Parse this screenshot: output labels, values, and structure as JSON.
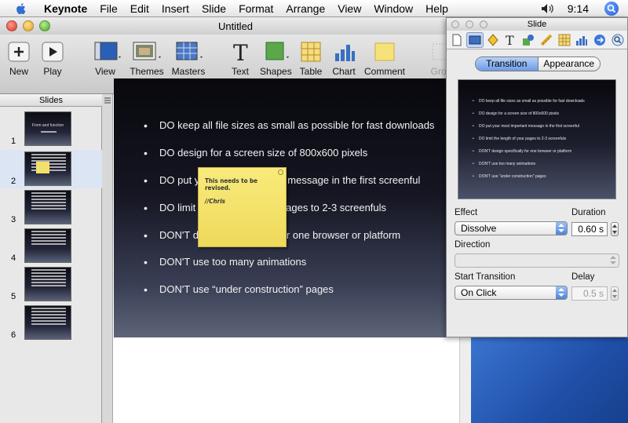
{
  "menubar": {
    "app": "Keynote",
    "items": [
      "File",
      "Edit",
      "Insert",
      "Slide",
      "Format",
      "Arrange",
      "View",
      "Window",
      "Help"
    ],
    "clock": "9:14"
  },
  "window": {
    "title": "Untitled"
  },
  "toolbar": {
    "new": "New",
    "play": "Play",
    "view": "View",
    "themes": "Themes",
    "masters": "Masters",
    "text": "Text",
    "shapes": "Shapes",
    "table": "Table",
    "chart": "Chart",
    "comment": "Comment",
    "group": "Grou"
  },
  "slides_pane": {
    "header": "Slides",
    "numbers": [
      "1",
      "2",
      "3",
      "4",
      "5",
      "6"
    ],
    "thumb1_title": "Form and function"
  },
  "slide": {
    "bullets": [
      "DO keep all file sizes as small as possible for fast downloads",
      "DO design for a screen size of 800x600 pixels",
      "DO put your most important message in the first screenful",
      "DO limit the length of your pages to 2-3 screenfuls",
      "DON'T design specifically for one browser or platform",
      "DON'T use too many animations",
      "DON'T use “under construction” pages"
    ],
    "comment_line1": "This needs to be revised.",
    "comment_line2": "//Chris"
  },
  "inspector": {
    "title": "Slide",
    "tabs": [
      "Transition",
      "Appearance"
    ],
    "preview_lines": [
      "DO keep all file sizes as small as possible for fast downloads",
      "DO design for a screen size of 800x600 pixels",
      "DO put your most important message in the first screenful",
      "DO limit the length of your pages to 2-3 screenfuls",
      "DON'T design specifically for one browser or platform",
      "DON'T use too many animations",
      "DON'T use \"under construction\" pages"
    ],
    "effect_label": "Effect",
    "effect_value": "Dissolve",
    "duration_label": "Duration",
    "duration_value": "0.60 s",
    "direction_label": "Direction",
    "start_label": "Start Transition",
    "start_value": "On Click",
    "delay_label": "Delay",
    "delay_value": "0.5 s"
  },
  "colors": {
    "accent": "#6c9ce8",
    "selection": "#dbe5f4",
    "sticky": "#f3e06a"
  }
}
